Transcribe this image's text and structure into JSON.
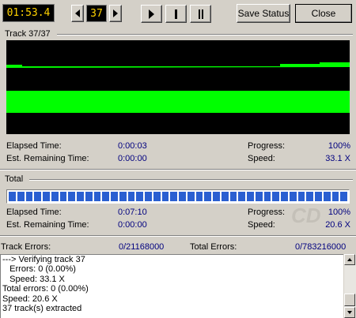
{
  "toolbar": {
    "time": "01:53.4",
    "track_number": "37",
    "save_status_label": "Save Status",
    "close_label": "Close"
  },
  "track": {
    "title": "Track 37/37",
    "elapsed_label": "Elapsed Time:",
    "elapsed_value": "0:00:03",
    "remaining_label": "Est. Remaining Time:",
    "remaining_value": "0:00:00",
    "progress_label": "Progress:",
    "progress_value": "100%",
    "speed_label": "Speed:",
    "speed_value": "33.1 X"
  },
  "total": {
    "title": "Total",
    "progress_fraction": 1.0,
    "elapsed_label": "Elapsed Time:",
    "elapsed_value": "0:07:10",
    "remaining_label": "Est. Remaining Time:",
    "remaining_value": "0:00:00",
    "progress_label": "Progress:",
    "progress_value": "100%",
    "speed_label": "Speed:",
    "speed_value": "20.6 X"
  },
  "errors": {
    "track_label": "Track Errors:",
    "track_value": "0/21168000",
    "total_label": "Total Errors:",
    "total_value": "0/783216000"
  },
  "log_lines": [
    "---> Verifying track 37",
    "   Errors: 0 (0.00%)",
    "   Speed: 33.1 X",
    "Total errors: 0 (0.00%)",
    "Speed: 20.6 X",
    "37 track(s) extracted"
  ],
  "colors": {
    "wave": "#00ff00",
    "lcd_text": "#ffd200",
    "value_text": "#00007f",
    "progress_fill": "#2a5fd1"
  }
}
